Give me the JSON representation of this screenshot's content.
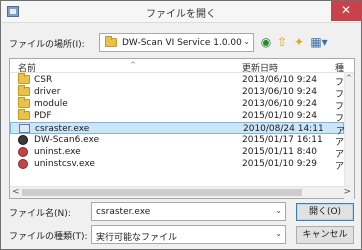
{
  "window": {
    "title": "ファイルを開く",
    "close_glyph": "✕"
  },
  "location": {
    "label": "ファイルの場所(I):",
    "folder": "DW-Scan VI Service 1.0.00"
  },
  "columns": {
    "name": "名前",
    "modified": "更新日時",
    "type": "種"
  },
  "files": [
    {
      "name": "CSR",
      "date": "2013/06/10 9:24",
      "type": "フ",
      "icon": "folder-icon"
    },
    {
      "name": "driver",
      "date": "2013/06/10 9:24",
      "type": "フ",
      "icon": "folder-icon"
    },
    {
      "name": "module",
      "date": "2013/06/10 9:24",
      "type": "フ",
      "icon": "folder-icon"
    },
    {
      "name": "PDF",
      "date": "2015/01/10 9:24",
      "type": "フ",
      "icon": "folder-icon"
    },
    {
      "name": "csraster.exe",
      "date": "2010/08/24 14:11",
      "type": "ア",
      "icon": "exe-icon",
      "selected": true
    },
    {
      "name": "DW-Scan6.exe",
      "date": "2015/01/17 16:11",
      "type": "ア",
      "icon": "dwscan-icon"
    },
    {
      "name": "uninst.exe",
      "date": "2015/01/11 8:40",
      "type": "ア",
      "icon": "uninstall-icon"
    },
    {
      "name": "uninstcsv.exe",
      "date": "2015/01/10 9:29",
      "type": "ア",
      "icon": "uninstall-icon"
    }
  ],
  "filename": {
    "label": "ファイル名(N):",
    "value": "csraster.exe"
  },
  "filetype": {
    "label": "ファイルの種類(T):",
    "value": "実行可能なファイル"
  },
  "buttons": {
    "open": "開く(O)",
    "cancel": "キャンセル"
  }
}
